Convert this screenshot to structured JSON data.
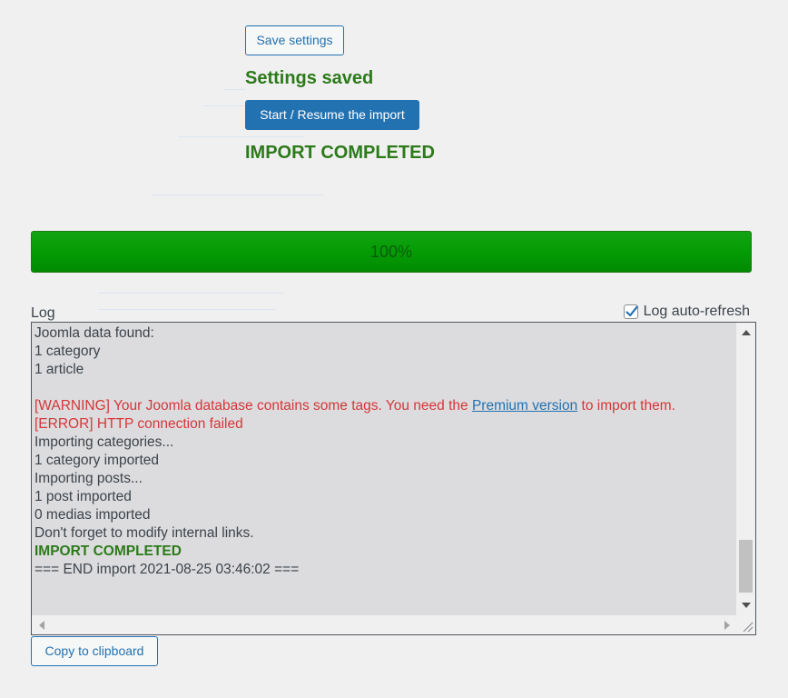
{
  "buttons": {
    "save_settings": "Save settings",
    "start_import": "Start / Resume the import",
    "copy_clipboard": "Copy to clipboard"
  },
  "messages": {
    "settings_saved": "Settings saved",
    "import_completed": "IMPORT COMPLETED"
  },
  "progress": {
    "value": 100,
    "label": "100%"
  },
  "log": {
    "label": "Log",
    "autorefresh_label": "Log auto-refresh",
    "autorefresh_checked": true,
    "lines": {
      "l1": "Joomla data found:",
      "l2": "1 category",
      "l3": "1 article",
      "warning_prefix": "[WARNING] Your Joomla database contains some tags. You need the ",
      "warning_link": "Premium version",
      "warning_suffix": " to import them.",
      "error": "[ERROR] HTTP connection failed",
      "l6": "Importing categories...",
      "l7": "1 category imported",
      "l8": "Importing posts...",
      "l9": "1 post imported",
      "l10": "0 medias imported",
      "l11": "Don't forget to modify internal links.",
      "completed": "IMPORT COMPLETED",
      "end": "=== END import 2021-08-25 03:46:02 ==="
    }
  },
  "colors": {
    "accent": "#2271b1",
    "success": "#2c7a19",
    "error": "#d63638",
    "progress_fill": "#049c04"
  }
}
